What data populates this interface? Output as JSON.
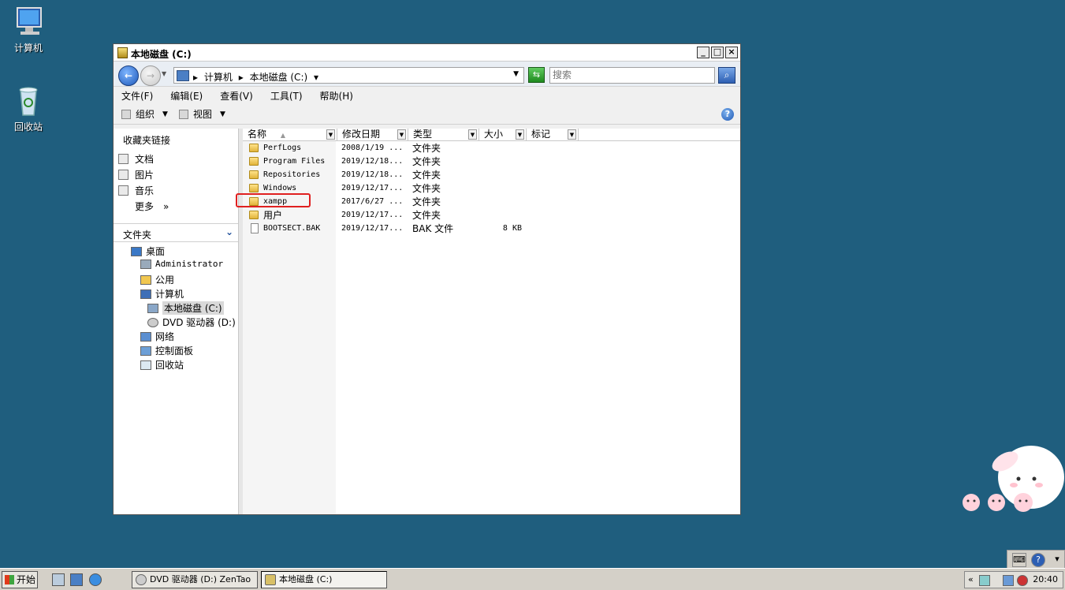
{
  "desktop": {
    "icons": [
      {
        "label": "计算机"
      },
      {
        "label": "回收站"
      }
    ]
  },
  "window": {
    "title": "本地磁盘 (C:)",
    "controls": {
      "minimize": "_",
      "maximize": "□",
      "close": "×"
    },
    "address": {
      "crumbs": [
        "计算机",
        "本地磁盘 (C:)"
      ]
    },
    "search": {
      "placeholder": "搜索"
    },
    "menu": [
      "文件(F)",
      "编辑(E)",
      "查看(V)",
      "工具(T)",
      "帮助(H)"
    ],
    "toolbar": {
      "organize": "组织",
      "views": "视图"
    },
    "nav": {
      "favorites_title": "收藏夹链接",
      "favorites": [
        "文档",
        "图片",
        "音乐"
      ],
      "more": "更多",
      "more_glyph": "»",
      "folders_title": "文件夹",
      "tree": [
        {
          "label": "桌面"
        },
        {
          "label": "Administrator"
        },
        {
          "label": "公用"
        },
        {
          "label": "计算机"
        },
        {
          "label": "本地磁盘 (C:)"
        },
        {
          "label": "DVD 驱动器 (D:)"
        },
        {
          "label": "网络"
        },
        {
          "label": "控制面板"
        },
        {
          "label": "回收站"
        }
      ]
    },
    "columns": [
      "名称",
      "修改日期",
      "类型",
      "大小",
      "标记"
    ],
    "files": [
      {
        "name": "PerfLogs",
        "date": "2008/1/19 ...",
        "type": "文件夹",
        "size": ""
      },
      {
        "name": "Program Files",
        "date": "2019/12/18...",
        "type": "文件夹",
        "size": ""
      },
      {
        "name": "Repositories",
        "date": "2019/12/18...",
        "type": "文件夹",
        "size": ""
      },
      {
        "name": "Windows",
        "date": "2019/12/17...",
        "type": "文件夹",
        "size": ""
      },
      {
        "name": "xampp",
        "date": "2017/6/27 ...",
        "type": "文件夹",
        "size": ""
      },
      {
        "name": "用户",
        "date": "2019/12/17...",
        "type": "文件夹",
        "size": ""
      },
      {
        "name": "BOOTSECT.BAK",
        "date": "2019/12/17...",
        "type": "BAK 文件",
        "size": "8 KB"
      }
    ]
  },
  "taskbar": {
    "start": "开始",
    "tasks": [
      {
        "label": "DVD 驱动器 (D:) ZenTao"
      },
      {
        "label": "本地磁盘 (C:)"
      }
    ],
    "clock": "20:40",
    "tray_toggle": "«"
  },
  "langbar": {
    "help": "?"
  }
}
